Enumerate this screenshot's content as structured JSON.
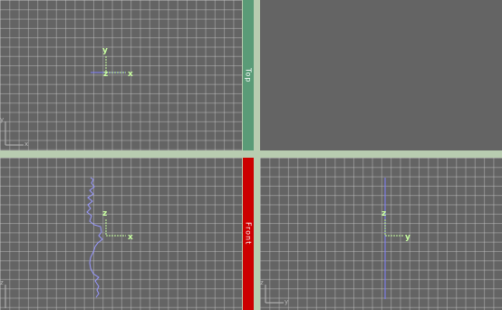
{
  "viewports": {
    "top_left": {
      "gizmo": {
        "y": "y",
        "x": "x",
        "z": "z"
      },
      "corner": {
        "y": "y",
        "x": "x"
      }
    },
    "top_right": {},
    "bottom_left": {
      "gizmo": {
        "z": "z",
        "x": "x"
      },
      "corner": {
        "z": "z"
      }
    },
    "bottom_right": {
      "gizmo": {
        "z": "z",
        "y": "y"
      },
      "corner": {
        "z": "z",
        "y": "y"
      }
    }
  },
  "labels": {
    "top": "Top",
    "front": "Front"
  },
  "colors": {
    "label_top_bg": "#5a9b77",
    "label_front_bg": "#cc0000",
    "gizmo_axis": "#c8ffa0",
    "curve": "#9999ff"
  }
}
